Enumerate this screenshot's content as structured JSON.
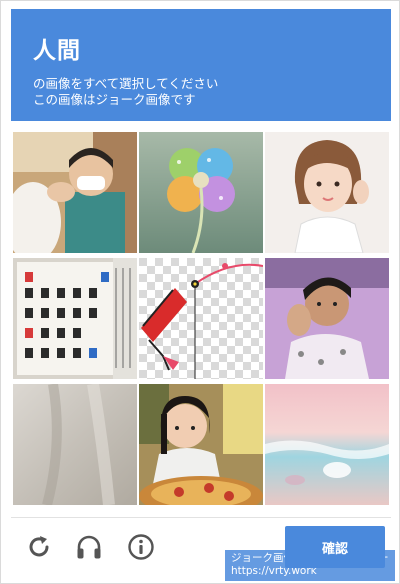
{
  "header": {
    "title": "人間",
    "line1": "の画像をすべて選択してください",
    "line2": "この画像はジョーク画像です"
  },
  "grid": {
    "tiles": [
      {
        "icon": "photo-child-mask"
      },
      {
        "icon": "photo-clover"
      },
      {
        "icon": "photo-woman-portrait"
      },
      {
        "icon": "photo-calendar"
      },
      {
        "icon": "photo-paint-tool"
      },
      {
        "icon": "photo-child-waving"
      },
      {
        "icon": "photo-blurry-fabric"
      },
      {
        "icon": "photo-girl-pizza"
      },
      {
        "icon": "photo-beach"
      }
    ]
  },
  "watermark": {
    "line1": "ジョーク画像認証ジェネレーター",
    "line2": "https://vrty.work"
  },
  "footer": {
    "verify_label": "確認"
  },
  "colors": {
    "accent": "#4a89dc",
    "icon": "#555555"
  }
}
